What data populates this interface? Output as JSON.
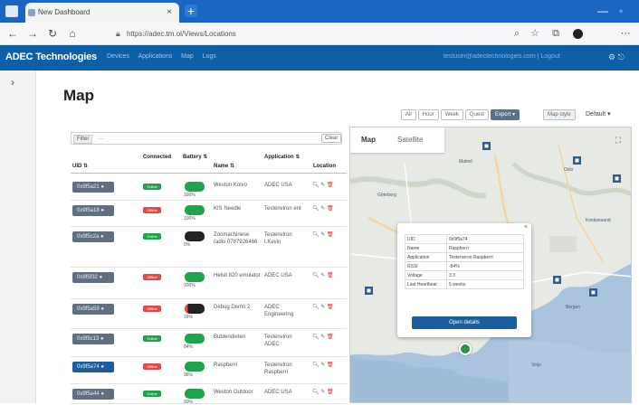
{
  "browser": {
    "tab_title": "New Dashboard",
    "url": "https://adec.tm.ol/Views/Locations",
    "new_tab_symbol": "+",
    "window_controls": [
      "—",
      "◦"
    ]
  },
  "app": {
    "brand": "ADEC Technologies",
    "nav": [
      "Devices",
      "Applications",
      "Map",
      "Logs"
    ],
    "user_text": "testuser@adectechnologies.com | Logout"
  },
  "page": {
    "title": "Map"
  },
  "toolbar": {
    "ranges": [
      "All",
      "Hour",
      "Week",
      "Quest",
      "Export ▾"
    ],
    "active_range": 4,
    "map_style_label": "Map style",
    "map_style_value": "Default ▾"
  },
  "filter": {
    "label": "Filter",
    "value": "...",
    "clear_label": "Clear"
  },
  "table": {
    "headers": {
      "uid": "UID ⇅",
      "connected": "Connected",
      "battery": "Battery ⇅",
      "name": "Name ⇅",
      "application": "Application ⇅",
      "location": "Location"
    },
    "rows": [
      {
        "uid": "0x9f5a21 ●",
        "connected": "online",
        "battery_pct": "100%",
        "battery_level": 1.0,
        "name": "Weston Kolvo",
        "application": "ADEC USA",
        "active": false
      },
      {
        "uid": "0x9f5a18 ●",
        "connected": "offline",
        "battery_pct": "100%",
        "battery_level": 1.0,
        "name": "KIS Needle",
        "application": "Testenviron ent",
        "active": false
      },
      {
        "uid": "0x9f5c2a ●",
        "connected": "online",
        "battery_pct": "0%",
        "battery_level": 0.0,
        "name": "Zoomachinese radio 0787926466",
        "application": "Testenviron t.Kevin",
        "active": false
      },
      {
        "uid": "0x9f5f32 ●",
        "connected": "offline",
        "battery_pct": "100%",
        "battery_level": 1.0,
        "name": "Helsit 820 emulator",
        "application": "ADEC USA",
        "active": false
      },
      {
        "uid": "0x9f5a59 ●",
        "connected": "offline",
        "battery_pct": "16%",
        "battery_level": 0.16,
        "name": "Debug Demo 2",
        "application": "ADEC Engineering",
        "active": false
      },
      {
        "uid": "0x9f5c13 ●",
        "connected": "online",
        "battery_pct": "84%",
        "battery_level": 0.84,
        "name": "Bublendieten",
        "application": "Testenviron ADEC",
        "active": false
      },
      {
        "uid": "0x9f5a74 ●",
        "connected": "offline",
        "battery_pct": "96%",
        "battery_level": 0.96,
        "name": "Raspberri",
        "application": "Testenviron Raspberri",
        "active": true
      },
      {
        "uid": "0x9f5a44 ●",
        "connected": "online",
        "battery_pct": "90%",
        "battery_level": 0.9,
        "name": "Weston Outdoor",
        "application": "ADEC USA",
        "active": false
      }
    ],
    "status_labels": {
      "online": "Online",
      "offline": "Offline"
    }
  },
  "map": {
    "tabs": [
      "Map",
      "Satellite"
    ],
    "labels": [
      "Malmö",
      "Göteborg",
      "Oslo",
      "Kristiansand",
      "Bergen",
      "Vinje"
    ],
    "popup": {
      "rows": [
        {
          "k": "UID",
          "v": "0x9f5a74"
        },
        {
          "k": "Name",
          "v": "Raspberri"
        },
        {
          "k": "Application",
          "v": "Testenviron Raspberri"
        },
        {
          "k": "RSSI",
          "v": "-84%"
        },
        {
          "k": "Voltage",
          "v": "3.3"
        },
        {
          "k": "Last Heartbeat",
          "v": "5 weeks"
        }
      ],
      "button": "Open details"
    }
  },
  "colors": {
    "brand": "#0d5fa8",
    "online": "#1fa44d",
    "offline": "#e04848",
    "battery_full": "#1fa44d",
    "battery_empty": "#222222",
    "uid_button": "#5f6f80"
  },
  "icons": [
    "window-icon",
    "back-icon",
    "forward-icon",
    "reload-icon",
    "home-icon",
    "lock-icon",
    "search-icon",
    "star-icon",
    "collections-icon",
    "extensions-icon",
    "menu-icon",
    "sidebar-toggle-icon",
    "map-pin-icon",
    "edit-icon",
    "delete-icon",
    "fullscreen-icon"
  ]
}
